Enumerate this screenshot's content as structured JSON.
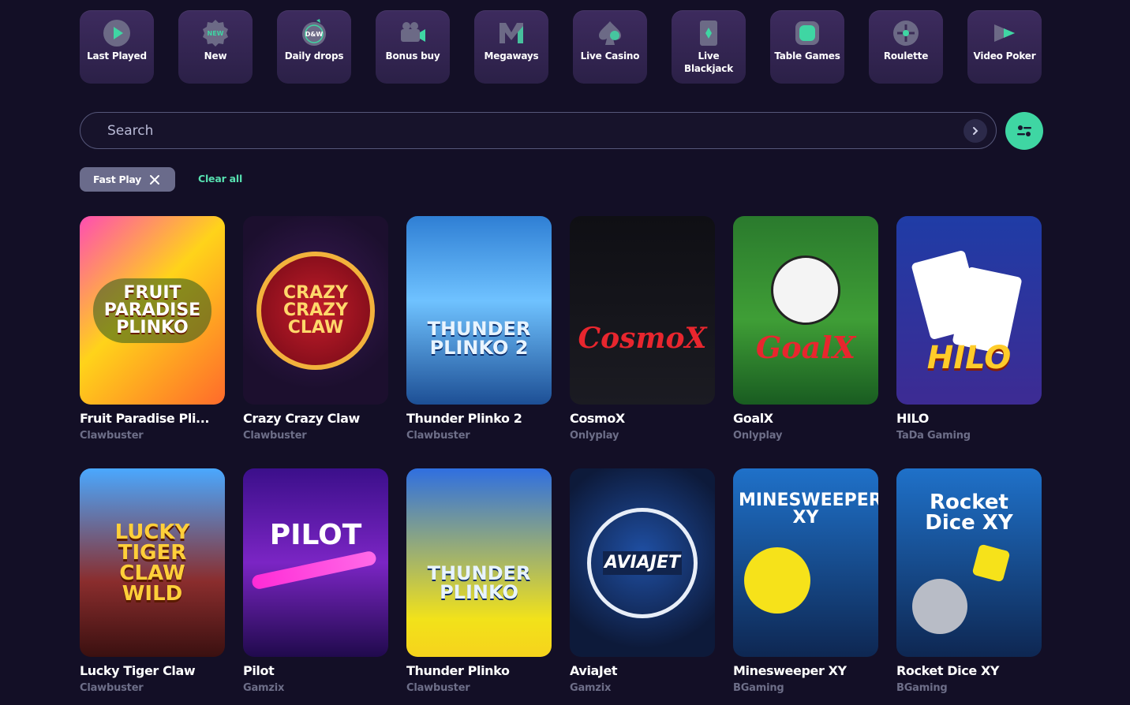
{
  "categories": [
    {
      "label": "Last Played",
      "icon": "play-icon"
    },
    {
      "label": "New",
      "icon": "new-badge-icon"
    },
    {
      "label": "Daily drops",
      "icon": "daily-drops-icon"
    },
    {
      "label": "Bonus buy",
      "icon": "camera-icon"
    },
    {
      "label": "Megaways",
      "icon": "megaways-icon"
    },
    {
      "label": "Live Casino",
      "icon": "spade-icon"
    },
    {
      "label": "Live Blackjack",
      "icon": "card-icon"
    },
    {
      "label": "Table Games",
      "icon": "table-icon"
    },
    {
      "label": "Roulette",
      "icon": "roulette-icon"
    },
    {
      "label": "Video Poker",
      "icon": "video-poker-icon"
    }
  ],
  "category_icon_text": {
    "new": "NEW",
    "daily": "D&W"
  },
  "search": {
    "placeholder": "Search"
  },
  "filters": {
    "active_chip": "Fast Play",
    "clear_all": "Clear all"
  },
  "games": [
    {
      "title": "Fruit Paradise Pli...",
      "provider": "Clawbuster",
      "art_text": "FRUIT PARADISE PLINKO"
    },
    {
      "title": "Crazy Crazy Claw",
      "provider": "Clawbuster",
      "art_text": "CRAZY CRAZY CLAW"
    },
    {
      "title": "Thunder Plinko 2",
      "provider": "Clawbuster",
      "art_text": "THUNDER PLINKO 2"
    },
    {
      "title": "CosmoX",
      "provider": "Onlyplay",
      "art_text": "CosmoX"
    },
    {
      "title": "GoalX",
      "provider": "Onlyplay",
      "art_text": "GoalX"
    },
    {
      "title": "HILO",
      "provider": "TaDa Gaming",
      "art_text": "HILO"
    },
    {
      "title": "Lucky Tiger Claw",
      "provider": "Clawbuster",
      "art_text": "LUCKY TIGER CLAW WILD"
    },
    {
      "title": "Pilot",
      "provider": "Gamzix",
      "art_text": "PILOT"
    },
    {
      "title": "Thunder Plinko",
      "provider": "Clawbuster",
      "art_text": "THUNDER PLINKO"
    },
    {
      "title": "AviaJet",
      "provider": "Gamzix",
      "art_text": "AVIAJET"
    },
    {
      "title": "Minesweeper XY",
      "provider": "BGaming",
      "art_text": "MINESWEEPER XY"
    },
    {
      "title": "Rocket Dice XY",
      "provider": "BGaming",
      "art_text": "Rocket Dice XY"
    }
  ],
  "colors": {
    "background": "#130f26",
    "tile": "#2e2349",
    "accent": "#3fd6a3",
    "chip": "#6a6b8b",
    "provider_text": "#6d6e88"
  }
}
